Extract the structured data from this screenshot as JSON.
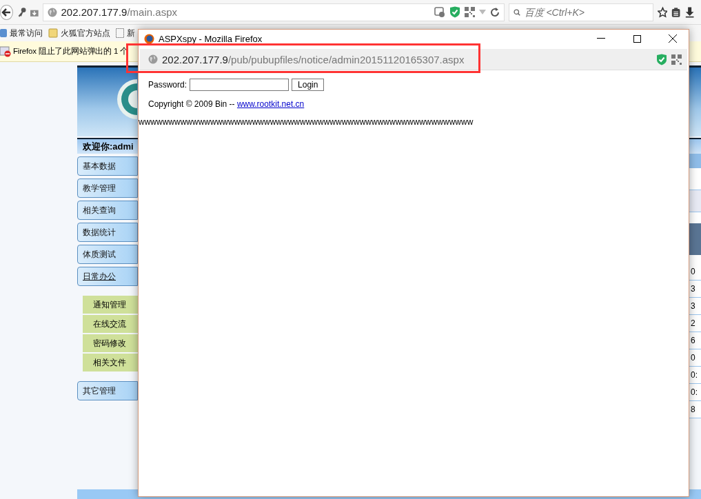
{
  "browser": {
    "address": {
      "host": "202.207.177.9",
      "path": "/main.aspx"
    },
    "search": {
      "placeholder": "百度 <Ctrl+K>"
    }
  },
  "bookmarks": [
    {
      "label": "最常访问",
      "kind": "smart"
    },
    {
      "label": "火狐官方站点",
      "kind": "folder"
    },
    {
      "label": "新",
      "kind": "page"
    }
  ],
  "notification": {
    "text": "Firefox 阻止了此网站弹出的 1 个"
  },
  "page": {
    "welcome": "欢迎你:admi",
    "menu": [
      {
        "label": "基本数据",
        "expanded": false
      },
      {
        "label": "教学管理",
        "expanded": false
      },
      {
        "label": "相关查询",
        "expanded": false
      },
      {
        "label": "数据统计",
        "expanded": false
      },
      {
        "label": "体质测试",
        "expanded": false
      },
      {
        "label": "日常办公",
        "expanded": true,
        "children": [
          {
            "label": "通知管理"
          },
          {
            "label": "在线交流"
          },
          {
            "label": "密码修改"
          },
          {
            "label": "相关文件"
          }
        ]
      },
      {
        "label": "其它管理",
        "expanded": false
      }
    ],
    "table_fragments": [
      "0",
      "3",
      "3",
      "2",
      "6",
      "0",
      "0:",
      "0:",
      "8"
    ]
  },
  "popup": {
    "title": "ASPXspy - Mozilla Firefox",
    "address": {
      "host": "202.207.177.9",
      "path": "/pub/pubupfiles/notice/admin20151120165307.aspx"
    },
    "password_label": "Password:",
    "login_button": "Login",
    "copyright": "Copyright © 2009 Bin -- ",
    "link": "www.rootkit.net.cn",
    "filler": "wwwwwwwwwwwwwwwwwwwwwwwwwwwwwwwwwwwwwwwwwwwwwwwwwwwwwwww"
  }
}
